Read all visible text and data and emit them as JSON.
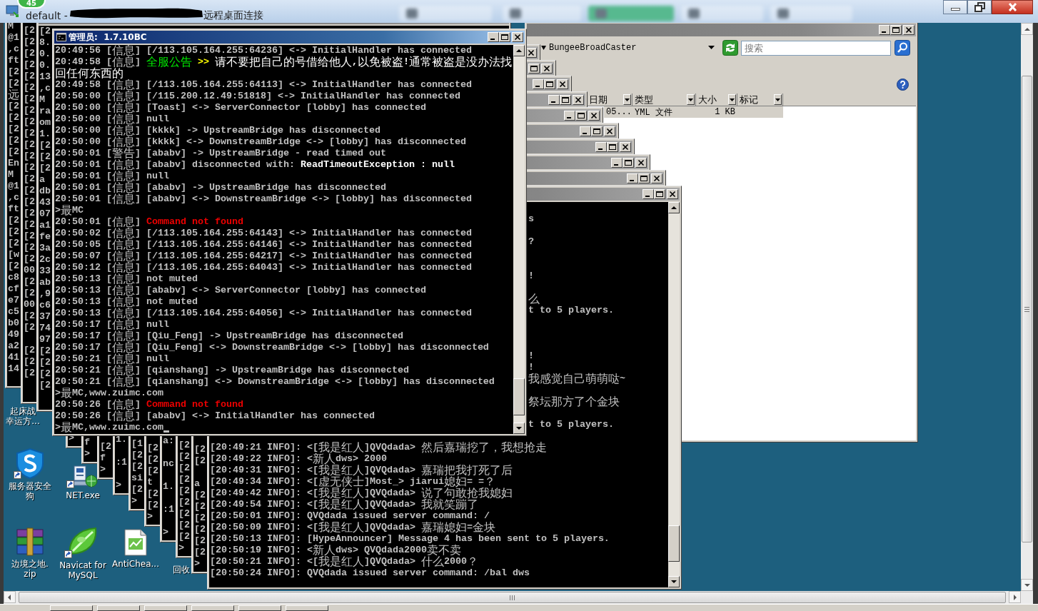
{
  "remote_bar": {
    "badge": "45",
    "title_prefix": "default -",
    "title_suffix": "远程桌面连接",
    "tabs": [
      {
        "selected": false
      },
      {
        "selected": false
      },
      {
        "selected": true
      },
      {
        "selected": false
      },
      {
        "selected": false
      }
    ]
  },
  "left_consoles": [
    {
      "lines": [
        "M",
        "@1",
        ",c",
        "ft",
        "[2",
        "[2",
        "远",
        "[2",
        "[2",
        "[2",
        "[2",
        "[2",
        "En",
        "M",
        "@1",
        ",c",
        "ft",
        "[2",
        "[2",
        "[2",
        "[w",
        "[2",
        "c8",
        "cf",
        "e7",
        "c5",
        "b0",
        "49",
        "a2",
        "41",
        "14"
      ]
    },
    {
      "lines": [
        "[2",
        "[2",
        "[2",
        "[2",
        "[2",
        "[2",
        "[2",
        "[2",
        "[2",
        "[2",
        "[2",
        "[2",
        "[2",
        "[2",
        "[2",
        "[2",
        "[2",
        "[2",
        "[2",
        "[2",
        "[2",
        "00",
        "[2",
        "[2",
        "00",
        "[2",
        "[2",
        "[2",
        "[2",
        "[2"
      ]
    },
    {
      "lines": [
        "[2",
        "8.",
        "0.",
        "0.",
        "13",
        ",c",
        "M",
        "ra",
        "om",
        "1.",
        "[2",
        "[2",
        "[2",
        "a",
        "db",
        "43",
        "07",
        "a1",
        "fe",
        "3a",
        "2c",
        "33",
        "ab",
        ",9",
        "c6",
        "37",
        "74",
        "97",
        "[2",
        "[2",
        "[2",
        "[2"
      ]
    }
  ],
  "main_console": {
    "title": "管理员:  1.7.10BC",
    "active": true,
    "cursor": true,
    "lines": [
      {
        "parts": [
          {
            "text": "20:49:56 [信息] [/113.105.164.255:64236] <-> InitialHandler has connected",
            "kind": "plain"
          }
        ]
      },
      {
        "parts": [
          {
            "text": "20:49:58 [信息] ",
            "kind": "plain"
          },
          {
            "text": "全服公告",
            "kind": "notice"
          },
          {
            "text": " >>",
            "kind": "arrow"
          },
          {
            "text": " 请不要把自己的号借给他人,以免被盗!通常被盗是没办法找回任何东西的",
            "kind": "bright"
          }
        ]
      },
      {
        "parts": [
          {
            "text": "20:49:58 [信息] [/113.105.164.255:64113] <-> InitialHandler has connected",
            "kind": "plain"
          }
        ]
      },
      {
        "parts": [
          {
            "text": "20:50:00 [信息] [/115.200.12.49:51818] <-> InitialHandler has connected",
            "kind": "plain"
          }
        ]
      },
      {
        "parts": [
          {
            "text": "20:50:00 [信息] [Toast] <-> ServerConnector [lobby] has connected",
            "kind": "plain"
          }
        ]
      },
      {
        "parts": [
          {
            "text": "20:50:00 [信息] null",
            "kind": "plain"
          }
        ]
      },
      {
        "parts": [
          {
            "text": "20:50:00 [信息] [kkkk] -> UpstreamBridge has disconnected",
            "kind": "plain"
          }
        ]
      },
      {
        "parts": [
          {
            "text": "20:50:00 [信息] [kkkk] <-> DownstreamBridge <-> [lobby] has disconnected",
            "kind": "plain"
          }
        ]
      },
      {
        "parts": [
          {
            "text": "20:50:01 [警告] [ababv] -> UpstreamBridge - read timed out",
            "kind": "plain"
          }
        ]
      },
      {
        "parts": [
          {
            "text": "20:50:01 [信息] [ababv] disconnected with: ",
            "kind": "plain"
          },
          {
            "text": "ReadTimeoutException : null",
            "kind": "bright"
          }
        ]
      },
      {
        "parts": [
          {
            "text": "20:50:01 [信息] null",
            "kind": "plain"
          }
        ]
      },
      {
        "parts": [
          {
            "text": "20:50:01 [信息] [ababv] -> UpstreamBridge has disconnected",
            "kind": "plain"
          }
        ]
      },
      {
        "parts": [
          {
            "text": "20:50:01 [信息] [ababv] <-> DownstreamBridge <-> [lobby] has disconnected",
            "kind": "plain"
          }
        ]
      },
      {
        "parts": [
          {
            "text": ">最MC",
            "kind": "plain"
          }
        ]
      },
      {
        "parts": [
          {
            "text": "20:50:01 [信息] ",
            "kind": "plain"
          },
          {
            "text": "Command not found",
            "kind": "error"
          }
        ]
      },
      {
        "parts": [
          {
            "text": "20:50:02 [信息] [/113.105.164.255:64143] <-> InitialHandler has connected",
            "kind": "plain"
          }
        ]
      },
      {
        "parts": [
          {
            "text": "20:50:05 [信息] [/113.105.164.255:64146] <-> InitialHandler has connected",
            "kind": "plain"
          }
        ]
      },
      {
        "parts": [
          {
            "text": "20:50:07 [信息] [/113.105.164.255:64217] <-> InitialHandler has connected",
            "kind": "plain"
          }
        ]
      },
      {
        "parts": [
          {
            "text": "20:50:12 [信息] [/113.105.164.255:64043] <-> InitialHandler has connected",
            "kind": "plain"
          }
        ]
      },
      {
        "parts": [
          {
            "text": "20:50:13 [信息] not muted",
            "kind": "plain"
          }
        ]
      },
      {
        "parts": [
          {
            "text": "20:50:13 [信息] [ababv] <-> ServerConnector [lobby] has connected",
            "kind": "plain"
          }
        ]
      },
      {
        "parts": [
          {
            "text": "20:50:13 [信息] not muted",
            "kind": "plain"
          }
        ]
      },
      {
        "parts": [
          {
            "text": "20:50:13 [信息] [/113.105.164.255:64056] <-> InitialHandler has connected",
            "kind": "plain"
          }
        ]
      },
      {
        "parts": [
          {
            "text": "20:50:17 [信息] null",
            "kind": "plain"
          }
        ]
      },
      {
        "parts": [
          {
            "text": "20:50:17 [信息] [Qiu_Feng] -> UpstreamBridge has disconnected",
            "kind": "plain"
          }
        ]
      },
      {
        "parts": [
          {
            "text": "20:50:17 [信息] [Qiu_Feng] <-> DownstreamBridge <-> [lobby] has disconnected",
            "kind": "plain"
          }
        ]
      },
      {
        "parts": [
          {
            "text": "20:50:21 [信息] null",
            "kind": "plain"
          }
        ]
      },
      {
        "parts": [
          {
            "text": "20:50:21 [信息] [qianshang] -> UpstreamBridge has disconnected",
            "kind": "plain"
          }
        ]
      },
      {
        "parts": [
          {
            "text": "20:50:21 [信息] [qianshang] <-> DownstreamBridge <-> [lobby] has disconnected",
            "kind": "plain"
          }
        ]
      },
      {
        "parts": [
          {
            "text": ">最MC,www.zuimc.com",
            "kind": "plain"
          }
        ]
      },
      {
        "parts": [
          {
            "text": "20:50:26 [信息] ",
            "kind": "plain"
          },
          {
            "text": "Command not found",
            "kind": "error"
          }
        ]
      },
      {
        "parts": [
          {
            "text": "20:50:26 [信息] [ababv] <-> InitialHandler has connected",
            "kind": "plain"
          }
        ]
      },
      {
        "parts": [
          {
            "text": ">最MC,www.zuimc.com",
            "kind": "plain"
          }
        ]
      }
    ]
  },
  "cascade_consoles": [
    {
      "active": false,
      "lines": [
        ">"
      ]
    },
    {
      "active": false,
      "lines": [
        "f",
        ">"
      ]
    },
    {
      "active": false,
      "lines": [
        "[2",
        "f",
        ">"
      ]
    },
    {
      "active": false,
      "lines": [
        "1.",
        ":1",
        ">"
      ]
    },
    {
      "active": false,
      "lines": [
        "[1",
        "[2",
        "[2",
        "si",
        "[2",
        ">"
      ]
    },
    {
      "active": false,
      "lines": [
        "[2",
        "[2",
        "[2",
        "t",
        "[2",
        "[2",
        ">"
      ]
    },
    {
      "active": false,
      "lines": [
        "a:",
        "nc",
        "1.",
        ":1",
        ">"
      ]
    },
    {
      "active": false,
      "lines": [
        "[2",
        "[2",
        "[2",
        "[2",
        "[2",
        "[2",
        "[2",
        "[2",
        "[2",
        ">"
      ]
    },
    {
      "active": false,
      "lines": [
        "[2",
        "[2",
        "a",
        "[2",
        "[2",
        "[2",
        "[2",
        "[2",
        "[2",
        ">"
      ]
    }
  ],
  "server_console": {
    "active": false,
    "right_fragments": [
      "s",
      "?",
      "!",
      "么",
      "t to 5 players.",
      "!",
      "!",
      "我感觉自己萌萌哒~",
      "祭坛那方了个金块",
      "t to 5 players."
    ],
    "lines": [
      "[20:49:21 INFO]: <[我是红人]QVQdada> 然后嘉瑞挖了，我想抢走",
      "[20:49:22 INFO]: <新人dws> 2000",
      "[20:49:31 INFO]: <[我是红人]QVQdada> 嘉瑞把我打死了后",
      "[20:49:34 INFO]: <[虚无侠士]Most_> jiarui媳妇= =？",
      "[20:49:42 INFO]: <[我是红人]QVQdada> 说了句敢抢我媳妇",
      "[20:49:54 INFO]: <[我是红人]QVQdada> 我就笑蹦了",
      "[20:50:01 INFO]: QVQdada issued server command: /",
      "[20:50:09 INFO]: <[我是红人]QVQdada> 嘉瑞媳妇=金块",
      "[20:50:13 INFO]: [HypeAnnouncer] Message 4 has been sent to 5 players.",
      "[20:50:19 INFO]: <新人dws> QVQdada2000卖不卖",
      "[20:50:21 INFO]: <[我是红人]QVQdada> 什么2000？",
      "[20:50:24 INFO]: QVQdada issued server command: /bal dws"
    ]
  },
  "explorer": {
    "active": false,
    "location": "BungeeBroadCaster",
    "search": {
      "placeholder": "搜索"
    },
    "columns": [
      "日期",
      "类型",
      "大小",
      "标记"
    ],
    "rows": [
      {
        "cells": [
          "05...",
          "YML 文件",
          "1 KB"
        ],
        "selected": true
      }
    ]
  },
  "desktop_icons": [
    {
      "label_lines": [
        "起床战",
        "幸运方..."
      ],
      "kind": "covered"
    },
    {
      "label_lines": [
        "服务器安全",
        "狗"
      ],
      "kind": "shield",
      "shortcut": true
    },
    {
      "label_lines": [
        "NET.exe"
      ],
      "kind": "computer",
      "shortcut": true
    },
    {
      "label_lines": [
        "边境之地.",
        "zip"
      ],
      "kind": "books",
      "shortcut": false
    },
    {
      "label_lines": [
        "Navicat for",
        "MySQL"
      ],
      "kind": "leaf",
      "shortcut": true
    },
    {
      "label_lines": [
        "AntiChea..."
      ],
      "kind": "document",
      "shortcut": false
    },
    {
      "label_lines": [
        "回收"
      ],
      "kind": "covered"
    }
  ]
}
